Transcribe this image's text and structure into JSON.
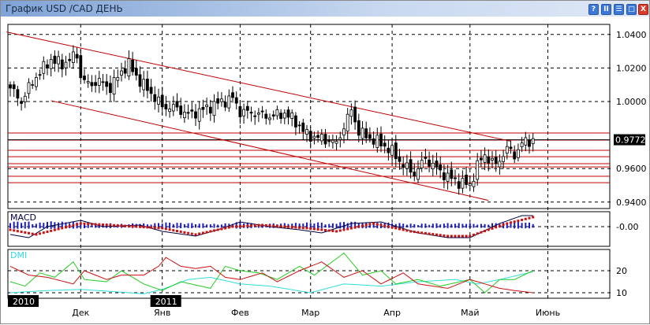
{
  "window": {
    "title": "График USD /CAD  ДЕНЬ",
    "buttons": [
      "?",
      "II",
      "☰",
      "□",
      "X"
    ]
  },
  "colors": {
    "up": "#ffffff",
    "down": "#000000",
    "levels": "#c00000",
    "macd_hist": "#1a1acc",
    "macd_signal": "#cc1111",
    "macd_line": "#000040",
    "adx": "#33dddd",
    "plus_di": "#22cc22",
    "minus_di": "#cc1111"
  },
  "chart_data": {
    "type": "candlestick",
    "title": "График USD /CAD  ДЕНЬ",
    "ylim": [
      0.933,
      1.0445
    ],
    "yticks": [
      "1.0400",
      "1.0200",
      "1.0000",
      "0.9600",
      "0.9400"
    ],
    "ytick_values": [
      1.04,
      1.02,
      1.0,
      0.96,
      0.94
    ],
    "current_price": "0.9772",
    "current_price_value": 0.9772,
    "n_days": 142,
    "close_keypoints": [
      [
        0,
        1.008
      ],
      [
        3,
        1.0
      ],
      [
        6,
        1.012
      ],
      [
        9,
        1.02
      ],
      [
        11,
        1.025
      ],
      [
        14,
        1.022
      ],
      [
        18,
        1.028
      ],
      [
        19,
        1.015
      ],
      [
        21,
        1.01
      ],
      [
        24,
        1.012
      ],
      [
        27,
        1.008
      ],
      [
        30,
        1.018
      ],
      [
        32,
        1.022
      ],
      [
        35,
        1.012
      ],
      [
        38,
        1.005
      ],
      [
        41,
        0.997
      ],
      [
        45,
        0.996
      ],
      [
        48,
        0.992
      ],
      [
        52,
        0.995
      ],
      [
        56,
        0.999
      ],
      [
        60,
        1.002
      ],
      [
        62,
        0.994
      ],
      [
        66,
        0.993
      ],
      [
        70,
        0.991
      ],
      [
        74,
        0.993
      ],
      [
        77,
        0.988
      ],
      [
        80,
        0.98
      ],
      [
        84,
        0.978
      ],
      [
        88,
        0.975
      ],
      [
        90,
        0.985
      ],
      [
        92,
        0.995
      ],
      [
        94,
        0.982
      ],
      [
        97,
        0.978
      ],
      [
        100,
        0.975
      ],
      [
        103,
        0.97
      ],
      [
        106,
        0.962
      ],
      [
        109,
        0.957
      ],
      [
        112,
        0.966
      ],
      [
        115,
        0.96
      ],
      [
        118,
        0.955
      ],
      [
        121,
        0.952
      ],
      [
        124,
        0.95
      ],
      [
        126,
        0.962
      ],
      [
        128,
        0.968
      ],
      [
        131,
        0.962
      ],
      [
        134,
        0.972
      ],
      [
        136,
        0.968
      ],
      [
        138,
        0.975
      ],
      [
        141,
        0.9772
      ]
    ],
    "levels": [
      0.9812,
      0.977,
      0.9709,
      0.9671,
      0.9629,
      0.961,
      0.9554,
      0.9516
    ],
    "trendlines": [
      [
        [
          -1,
          1.0415
        ],
        [
          135,
          0.9763
        ]
      ],
      [
        [
          11,
          1.0005
        ],
        [
          129,
          0.941
        ]
      ]
    ],
    "months": [
      {
        "label": "Дек",
        "day": 19
      },
      {
        "label": "Янв",
        "day": 41
      },
      {
        "label": "Фев",
        "day": 62
      },
      {
        "label": "Мар",
        "day": 81
      },
      {
        "label": "Апр",
        "day": 103
      },
      {
        "label": "Май",
        "day": 124
      },
      {
        "label": "Июнь",
        "day": 145
      }
    ],
    "years": [
      {
        "label": "2010",
        "day": -1
      },
      {
        "label": "2011",
        "day": 41
      }
    ],
    "macd": {
      "label": "MACD",
      "ytick": "-0.00",
      "line_keypoints": [
        [
          0,
          -0.005
        ],
        [
          5,
          -0.007
        ],
        [
          10,
          0.0
        ],
        [
          19,
          0.004
        ],
        [
          25,
          0.0
        ],
        [
          35,
          0.001
        ],
        [
          41,
          -0.003
        ],
        [
          50,
          -0.006
        ],
        [
          56,
          -0.002
        ],
        [
          62,
          0.003
        ],
        [
          70,
          0.0
        ],
        [
          78,
          -0.002
        ],
        [
          84,
          -0.004
        ],
        [
          92,
          0.002
        ],
        [
          100,
          0.003
        ],
        [
          110,
          -0.004
        ],
        [
          118,
          -0.007
        ],
        [
          124,
          -0.007
        ],
        [
          132,
          0.002
        ],
        [
          138,
          0.007
        ],
        [
          141,
          0.007
        ]
      ],
      "signal_keypoints": [
        [
          0,
          -0.002
        ],
        [
          7,
          -0.005
        ],
        [
          19,
          0.002
        ],
        [
          27,
          0.001
        ],
        [
          41,
          -0.001
        ],
        [
          50,
          -0.005
        ],
        [
          60,
          0.0
        ],
        [
          68,
          0.001
        ],
        [
          80,
          -0.001
        ],
        [
          88,
          -0.003
        ],
        [
          98,
          0.002
        ],
        [
          108,
          -0.003
        ],
        [
          118,
          -0.006
        ],
        [
          124,
          -0.006
        ],
        [
          134,
          0.002
        ],
        [
          141,
          0.006
        ]
      ]
    },
    "dmi": {
      "label": "DMI",
      "yticks": [
        "20",
        "10"
      ],
      "ytick_values": [
        20,
        10
      ],
      "adx_keypoints": [
        [
          0,
          10
        ],
        [
          10,
          11
        ],
        [
          19,
          11.5
        ],
        [
          28,
          10.5
        ],
        [
          36,
          9.5
        ],
        [
          41,
          11.5
        ],
        [
          48,
          16
        ],
        [
          54,
          17
        ],
        [
          62,
          14
        ],
        [
          70,
          13
        ],
        [
          81,
          10
        ],
        [
          90,
          14
        ],
        [
          100,
          13
        ],
        [
          110,
          15
        ],
        [
          120,
          16
        ],
        [
          126,
          14
        ],
        [
          132,
          16
        ],
        [
          141,
          19.5
        ]
      ],
      "plus_di_keypoints": [
        [
          0,
          15
        ],
        [
          4,
          13
        ],
        [
          8,
          19
        ],
        [
          12,
          17
        ],
        [
          17,
          24
        ],
        [
          20,
          16
        ],
        [
          26,
          15
        ],
        [
          30,
          20
        ],
        [
          36,
          14
        ],
        [
          41,
          11
        ],
        [
          46,
          15
        ],
        [
          54,
          12
        ],
        [
          58,
          22
        ],
        [
          62,
          20
        ],
        [
          67,
          19
        ],
        [
          72,
          16
        ],
        [
          78,
          22
        ],
        [
          82,
          18
        ],
        [
          90,
          28
        ],
        [
          95,
          18
        ],
        [
          100,
          20
        ],
        [
          104,
          14
        ],
        [
          110,
          16
        ],
        [
          116,
          13
        ],
        [
          124,
          16
        ],
        [
          128,
          10
        ],
        [
          132,
          16
        ],
        [
          136,
          16
        ],
        [
          141,
          20
        ]
      ],
      "minus_di_keypoints": [
        [
          0,
          22
        ],
        [
          5,
          18
        ],
        [
          10,
          17
        ],
        [
          17,
          14
        ],
        [
          20,
          20
        ],
        [
          26,
          16
        ],
        [
          30,
          18
        ],
        [
          36,
          18
        ],
        [
          40,
          22
        ],
        [
          42,
          26
        ],
        [
          46,
          22
        ],
        [
          50,
          21
        ],
        [
          54,
          22
        ],
        [
          58,
          17
        ],
        [
          62,
          16
        ],
        [
          68,
          19
        ],
        [
          72,
          15
        ],
        [
          78,
          20
        ],
        [
          84,
          24
        ],
        [
          90,
          17
        ],
        [
          95,
          20
        ],
        [
          100,
          14
        ],
        [
          106,
          19
        ],
        [
          110,
          14
        ],
        [
          118,
          12
        ],
        [
          124,
          16
        ],
        [
          128,
          14
        ],
        [
          132,
          12
        ],
        [
          136,
          11
        ],
        [
          141,
          10
        ]
      ]
    }
  }
}
